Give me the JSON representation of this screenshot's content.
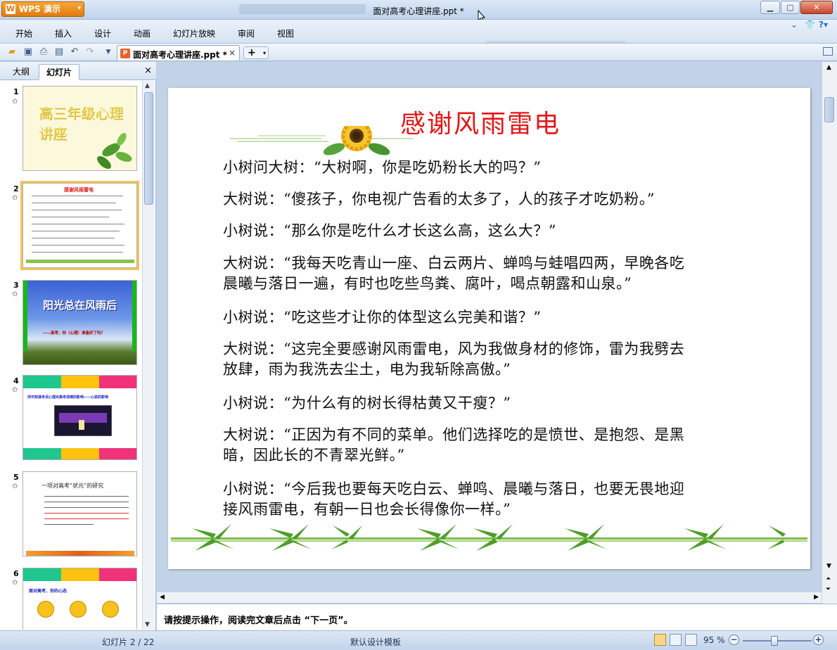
{
  "window": {
    "app_name": "WPS 演示",
    "title": "面对高考心理讲座.ppt *",
    "minimize_icon": "minimize-icon",
    "maximize_icon": "maximize-icon",
    "close_icon": "close-icon"
  },
  "menu": {
    "items": [
      "开始",
      "插入",
      "设计",
      "动画",
      "幻灯片放映",
      "审阅",
      "视图"
    ]
  },
  "toolbar": {
    "doc_tab_label": "面对高考心理讲座.ppt *",
    "new_tab_label": "+"
  },
  "left_panel": {
    "tab_outline": "大纲",
    "tab_slides": "幻灯片",
    "close": "×",
    "thumbnails": [
      {
        "number": "1",
        "title": "高三年级心理讲座"
      },
      {
        "number": "2",
        "title": "感谢风雨雷电"
      },
      {
        "number": "3",
        "title": "阳光总在风雨后",
        "subtitle": "——高考，你（心理）准备好了吗？"
      },
      {
        "number": "4",
        "line1": "你可知道考试心理对高考成绩的影响——心态的影响"
      },
      {
        "number": "5",
        "title": "一项对高考“状元”的研究"
      },
      {
        "number": "6",
        "line1": "面对高考，你的心态"
      }
    ]
  },
  "slide": {
    "title": "感谢风雨雷电",
    "paragraphs": [
      [
        "小树问大树：“大树啊，你是吃奶粉长大的吗？”"
      ],
      [
        "大树说：“傻孩子，你电视广告看的太多了，人的孩子才吃奶粉。”"
      ],
      [
        "小树说：“那么你是吃什么才长这么高，这么大？”"
      ],
      [
        "大树说：“我每天吃青山一座、白云两片、蝉鸣与蛙唱四两，早晚各吃",
        "晨曦与落日一遍，有时也吃些鸟粪、腐叶，喝点朝露和山泉。”"
      ],
      [
        "小树说：“吃这些才让你的体型这么完美和谐？”"
      ],
      [
        "大树说：“这完全要感谢风雨雷电，风为我做身材的修饰，雷为我劈去",
        "放肆，雨为我洗去尘土，电为我斩除高傲。”"
      ],
      [
        "小树说：“为什么有的树长得枯黄又干瘦？”"
      ],
      [
        "大树说：“正因为有不同的菜单。他们选择吃的是愤世、是抱怨、是黑",
        "暗，因此长的不青翠光鲜。”"
      ],
      [
        "小树说：“今后我也要每天吃白云、蝉鸣、晨曦与落日，也要无畏地迎",
        "接风雨雷电，有朝一日也会长得像你一样。”"
      ]
    ]
  },
  "notes": {
    "text": "请按提示操作，阅读完文章后点击 “下一页”。"
  },
  "status": {
    "slide_counter": "幻灯片 2 / 22",
    "template": "默认设计模板",
    "zoom": "95 %"
  },
  "colors": {
    "title_red": "#e41616",
    "wps_orange": "#f08c1e",
    "chrome_blue": "#c3d3e7"
  }
}
